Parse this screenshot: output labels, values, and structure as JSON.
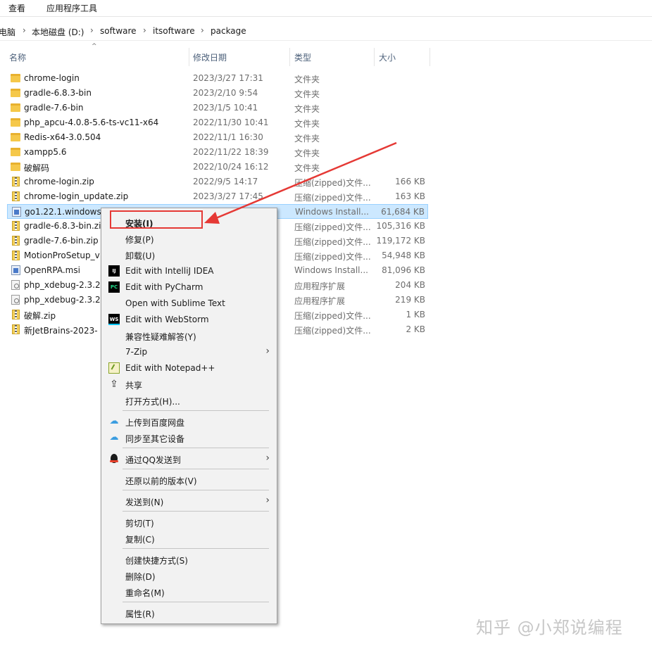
{
  "ribbon": {
    "tabs": [
      "查看",
      "应用程序工具"
    ]
  },
  "breadcrumb": [
    "电脑",
    "本地磁盘 (D:)",
    "software",
    "itsoftware",
    "package"
  ],
  "columns": {
    "name": "名称",
    "date": "修改日期",
    "type": "类型",
    "size": "大小"
  },
  "files": [
    {
      "name": "chrome-login",
      "date": "2023/3/27 17:31",
      "type": "文件夹",
      "size": "",
      "icon": "folder-icon"
    },
    {
      "name": "gradle-6.8.3-bin",
      "date": "2023/2/10 9:54",
      "type": "文件夹",
      "size": "",
      "icon": "folder-icon"
    },
    {
      "name": "gradle-7.6-bin",
      "date": "2023/1/5 10:41",
      "type": "文件夹",
      "size": "",
      "icon": "folder-icon"
    },
    {
      "name": "php_apcu-4.0.8-5.6-ts-vc11-x64",
      "date": "2022/11/30 10:41",
      "type": "文件夹",
      "size": "",
      "icon": "folder-icon"
    },
    {
      "name": "Redis-x64-3.0.504",
      "date": "2022/11/1 16:30",
      "type": "文件夹",
      "size": "",
      "icon": "folder-icon"
    },
    {
      "name": "xampp5.6",
      "date": "2022/11/22 18:39",
      "type": "文件夹",
      "size": "",
      "icon": "folder-icon"
    },
    {
      "name": "破解码",
      "date": "2022/10/24 16:12",
      "type": "文件夹",
      "size": "",
      "icon": "folder-icon"
    },
    {
      "name": "chrome-login.zip",
      "date": "2022/9/5 14:17",
      "type": "压缩(zipped)文件...",
      "size": "166 KB",
      "icon": "zip-icon"
    },
    {
      "name": "chrome-login_update.zip",
      "date": "2023/3/27 17:45",
      "type": "压缩(zipped)文件...",
      "size": "163 KB",
      "icon": "zip-icon"
    },
    {
      "name": "go1.22.1.windows-",
      "date": "",
      "type": "Windows Install...",
      "size": "61,684 KB",
      "icon": "msi-icon",
      "selected": true
    },
    {
      "name": "gradle-6.8.3-bin.zip",
      "date": "",
      "type": "压缩(zipped)文件...",
      "size": "105,316 KB",
      "icon": "zip-icon"
    },
    {
      "name": "gradle-7.6-bin.zip",
      "date": "",
      "type": "压缩(zipped)文件...",
      "size": "119,172 KB",
      "icon": "zip-icon"
    },
    {
      "name": "MotionProSetup_v",
      "date": "",
      "type": "压缩(zipped)文件...",
      "size": "54,948 KB",
      "icon": "zip-icon"
    },
    {
      "name": "OpenRPA.msi",
      "date": "",
      "type": "Windows Install...",
      "size": "81,096 KB",
      "icon": "msi-icon"
    },
    {
      "name": "php_xdebug-2.3.2-",
      "date": "",
      "type": "应用程序扩展",
      "size": "204 KB",
      "icon": "dll-icon"
    },
    {
      "name": "php_xdebug-2.3.2-",
      "date": "",
      "type": "应用程序扩展",
      "size": "219 KB",
      "icon": "dll-icon"
    },
    {
      "name": "破解.zip",
      "date": "",
      "type": "压缩(zipped)文件...",
      "size": "1 KB",
      "icon": "zip-icon"
    },
    {
      "name": "新JetBrains-2023-",
      "date": "",
      "type": "压缩(zipped)文件...",
      "size": "2 KB",
      "icon": "zip-icon"
    }
  ],
  "context_menu": {
    "install": "安装(I)",
    "repair": "修复(P)",
    "uninstall": "卸载(U)",
    "intellij": "Edit with IntelliJ IDEA",
    "pycharm": "Edit with PyCharm",
    "sublime": "Open with Sublime Text",
    "webstorm": "Edit with WebStorm",
    "compat": "兼容性疑难解答(Y)",
    "sevenzip": "7-Zip",
    "notepadpp": "Edit with Notepad++",
    "share": "共享",
    "open_with": "打开方式(H)...",
    "upload_baidu": "上传到百度网盘",
    "sync_devices": "同步至其它设备",
    "send_qq": "通过QQ发送到",
    "restore": "还原以前的版本(V)",
    "send_to": "发送到(N)",
    "cut": "剪切(T)",
    "copy": "复制(C)",
    "create_shortcut": "创建快捷方式(S)",
    "delete": "删除(D)",
    "rename": "重命名(M)",
    "properties": "属性(R)",
    "icon_labels": {
      "intellij": "IJ",
      "pycharm": "PC",
      "webstorm": "WS"
    }
  },
  "watermark": "知乎 @小郑说编程",
  "colors": {
    "highlight_border": "#e53935",
    "arrow": "#e53935",
    "selection": "#cce8ff"
  }
}
